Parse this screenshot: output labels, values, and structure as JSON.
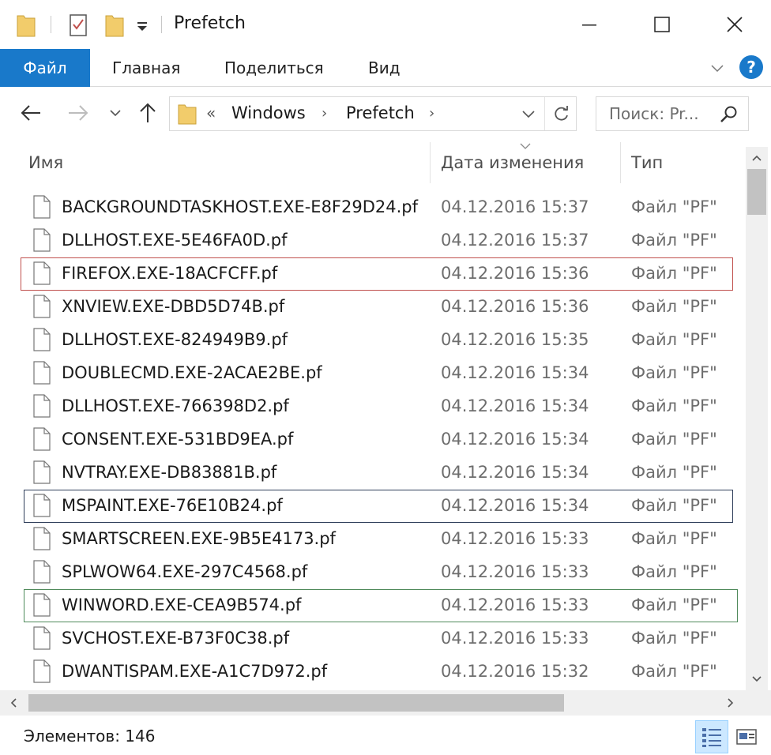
{
  "window": {
    "title": "Prefetch",
    "controls": {
      "minimize": "—",
      "maximize": "☐",
      "close": "✕"
    }
  },
  "ribbon": {
    "tabs": [
      {
        "label": "Файл",
        "active": true
      },
      {
        "label": "Главная"
      },
      {
        "label": "Поделиться"
      },
      {
        "label": "Вид"
      }
    ],
    "help": "?"
  },
  "address": {
    "prefix": "«",
    "crumbs": [
      "Windows",
      "Prefetch"
    ],
    "separator": "›"
  },
  "search": {
    "placeholder": "Поиск: Pr..."
  },
  "columns": {
    "name": "Имя",
    "date": "Дата изменения",
    "type": "Тип"
  },
  "files": [
    {
      "name": "BACKGROUNDTASKHOST.EXE-E8F29D24.pf",
      "date": "04.12.2016 15:37",
      "type": "Файл \"PF\""
    },
    {
      "name": "DLLHOST.EXE-5E46FA0D.pf",
      "date": "04.12.2016 15:37",
      "type": "Файл \"PF\""
    },
    {
      "name": "FIREFOX.EXE-18ACFCFF.pf",
      "date": "04.12.2016 15:36",
      "type": "Файл \"PF\"",
      "highlight": "#c0504d"
    },
    {
      "name": "XNVIEW.EXE-DBD5D74B.pf",
      "date": "04.12.2016 15:36",
      "type": "Файл \"PF\""
    },
    {
      "name": "DLLHOST.EXE-824949B9.pf",
      "date": "04.12.2016 15:35",
      "type": "Файл \"PF\""
    },
    {
      "name": "DOUBLECMD.EXE-2ACAE2BE.pf",
      "date": "04.12.2016 15:34",
      "type": "Файл \"PF\""
    },
    {
      "name": "DLLHOST.EXE-766398D2.pf",
      "date": "04.12.2016 15:34",
      "type": "Файл \"PF\""
    },
    {
      "name": "CONSENT.EXE-531BD9EA.pf",
      "date": "04.12.2016 15:34",
      "type": "Файл \"PF\""
    },
    {
      "name": "NVTRAY.EXE-DB83881B.pf",
      "date": "04.12.2016 15:34",
      "type": "Файл \"PF\""
    },
    {
      "name": "MSPAINT.EXE-76E10B24.pf",
      "date": "04.12.2016 15:34",
      "type": "Файл \"PF\"",
      "highlight": "#2f3e5a"
    },
    {
      "name": "SMARTSCREEN.EXE-9B5E4173.pf",
      "date": "04.12.2016 15:33",
      "type": "Файл \"PF\""
    },
    {
      "name": "SPLWOW64.EXE-297C4568.pf",
      "date": "04.12.2016 15:33",
      "type": "Файл \"PF\""
    },
    {
      "name": "WINWORD.EXE-CEA9B574.pf",
      "date": "04.12.2016 15:33",
      "type": "Файл \"PF\"",
      "highlight": "#4f8a5b"
    },
    {
      "name": "SVCHOST.EXE-B73F0C38.pf",
      "date": "04.12.2016 15:33",
      "type": "Файл \"PF\""
    },
    {
      "name": "DWANTISPAM.EXE-A1C7D972.pf",
      "date": "04.12.2016 15:32",
      "type": "Файл \"PF\""
    }
  ],
  "status": {
    "items": "Элементов: 146"
  },
  "colors": {
    "accent": "#1979ca",
    "folder": "#f2cc6b"
  }
}
